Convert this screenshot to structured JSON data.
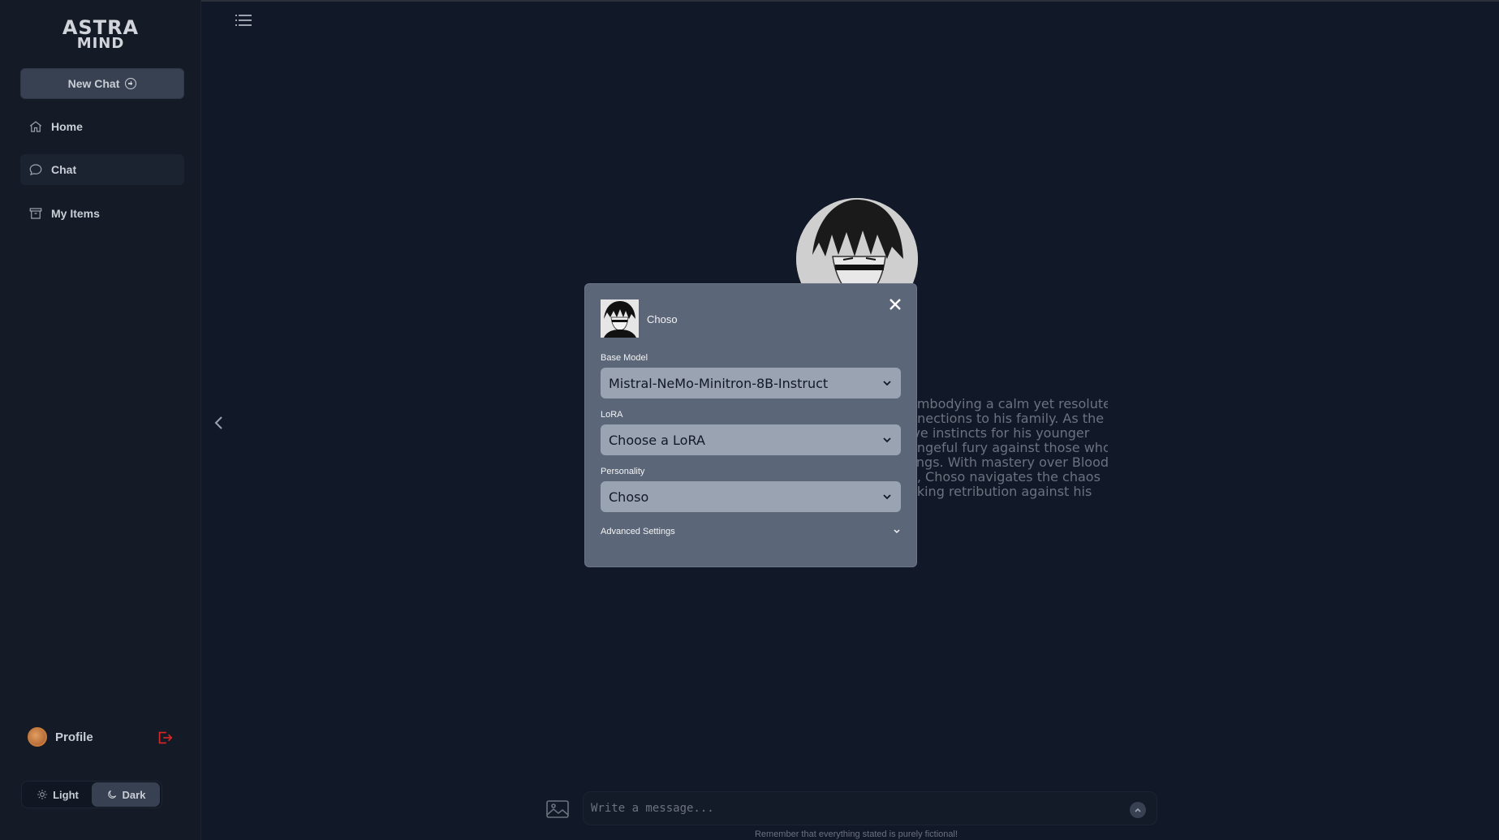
{
  "app": {
    "logo_line1": "ASTRA",
    "logo_line2": "MIND"
  },
  "sidebar": {
    "new_chat_label": "New Chat",
    "items": [
      {
        "label": "Home",
        "icon": "home-icon"
      },
      {
        "label": "Chat",
        "icon": "chat-bubble-icon",
        "active": true
      },
      {
        "label": "My Items",
        "icon": "archive-box-icon"
      }
    ],
    "profile_label": "Profile",
    "theme": {
      "light_label": "Light",
      "dark_label": "Dark",
      "selected": "Dark"
    }
  },
  "character": {
    "description_lines": [
      "embodying a calm yet resolute",
      "nnections to his family. As the",
      "ive instincts for his younger",
      "engeful fury against those who",
      "lings. With mastery over Blood",
      "e, Choso navigates the chaos",
      "eking retribution against his"
    ]
  },
  "modal": {
    "character_name": "Choso",
    "base_model_label": "Base Model",
    "base_model_value": "Mistral-NeMo-Minitron-8B-Instruct",
    "lora_label": "LoRA",
    "lora_value": "Choose a LoRA",
    "personality_label": "Personality",
    "personality_value": "Choso",
    "advanced_settings_label": "Advanced Settings"
  },
  "composer": {
    "placeholder": "Write a message...",
    "footnote": "Remember that everything stated is purely fictional!"
  },
  "colors": {
    "background": "#111827",
    "sidebar": "#151b26",
    "modal": "#5b6678",
    "select": "#9aa3b2",
    "logout_accent": "#dc2626"
  }
}
